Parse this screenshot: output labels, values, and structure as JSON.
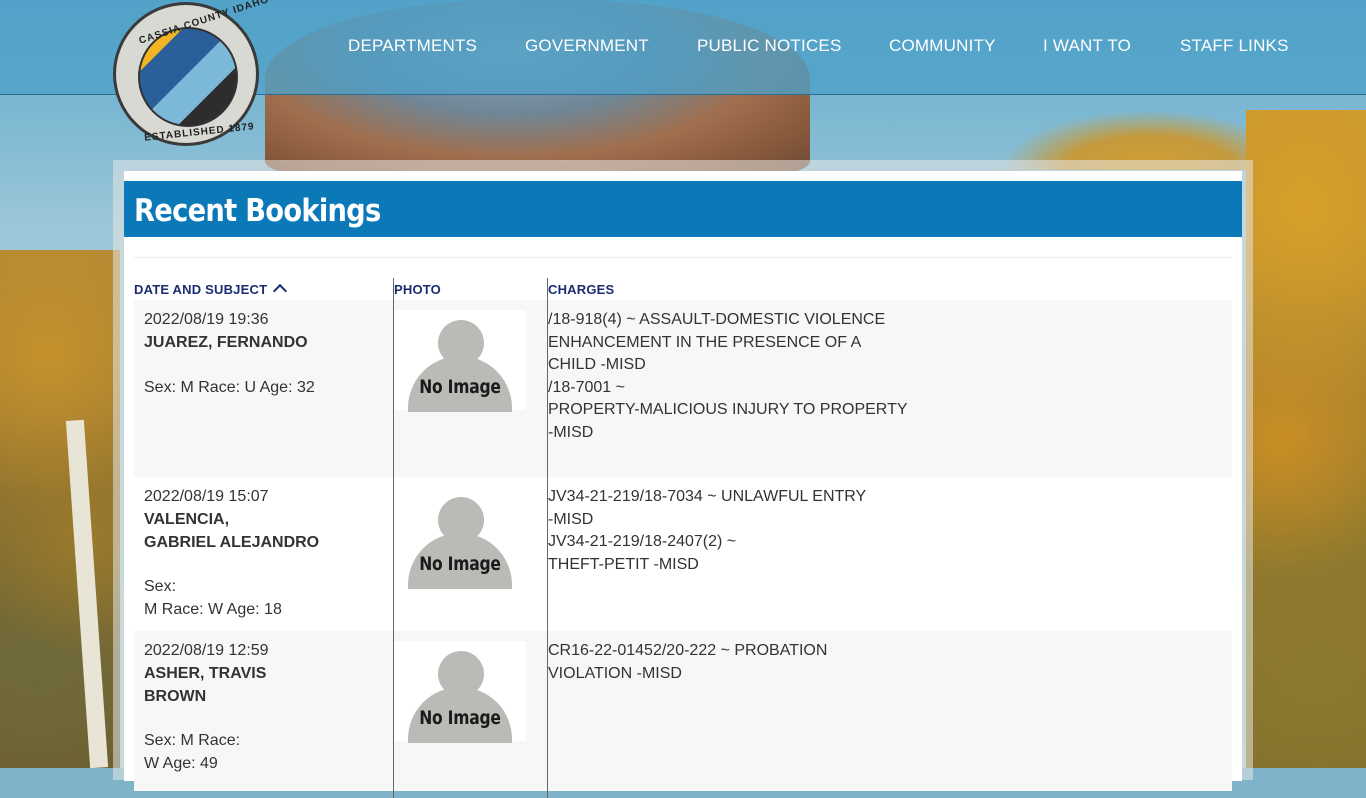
{
  "nav": {
    "items": [
      "DEPARTMENTS",
      "GOVERNMENT",
      "PUBLIC NOTICES",
      "COMMUNITY",
      "I WANT TO",
      "STAFF LINKS"
    ]
  },
  "seal": {
    "top_text": "CASSIA COUNTY IDAHO",
    "bottom_text": "ESTABLISHED 1879"
  },
  "page": {
    "title": "Recent Bookings"
  },
  "table": {
    "headers": {
      "date_subject": "DATE AND SUBJECT",
      "photo": "PHOTO",
      "charges": "CHARGES"
    },
    "no_image_label": "No Image",
    "rows": [
      {
        "datetime": "2022/08/19 19:36",
        "name_lines": [
          "JUAREZ, FERNANDO"
        ],
        "demo_lines": [
          "Sex: M Race: U Age: 32"
        ],
        "charges": [
          "/18-918(4) ~ ASSAULT-DOMESTIC VIOLENCE",
          "ENHANCEMENT IN THE PRESENCE OF A",
          "CHILD -MISD",
          "/18-7001 ~",
          "PROPERTY-MALICIOUS INJURY TO PROPERTY",
          "-MISD"
        ]
      },
      {
        "datetime": "2022/08/19 15:07",
        "name_lines": [
          "VALENCIA,",
          "GABRIEL ALEJANDRO"
        ],
        "demo_lines": [
          "Sex:",
          "M Race: W Age: 18"
        ],
        "charges": [
          "JV34-21-219/18-7034 ~ UNLAWFUL ENTRY",
          "-MISD",
          "JV34-21-219/18-2407(2) ~",
          "THEFT-PETIT -MISD"
        ]
      },
      {
        "datetime": "2022/08/19 12:59",
        "name_lines": [
          "ASHER, TRAVIS",
          "BROWN"
        ],
        "demo_lines": [
          "Sex: M Race:",
          "W Age: 49"
        ],
        "charges": [
          "CR16-22-01452/20-222 ~ PROBATION",
          "VIOLATION -MISD"
        ]
      }
    ]
  }
}
